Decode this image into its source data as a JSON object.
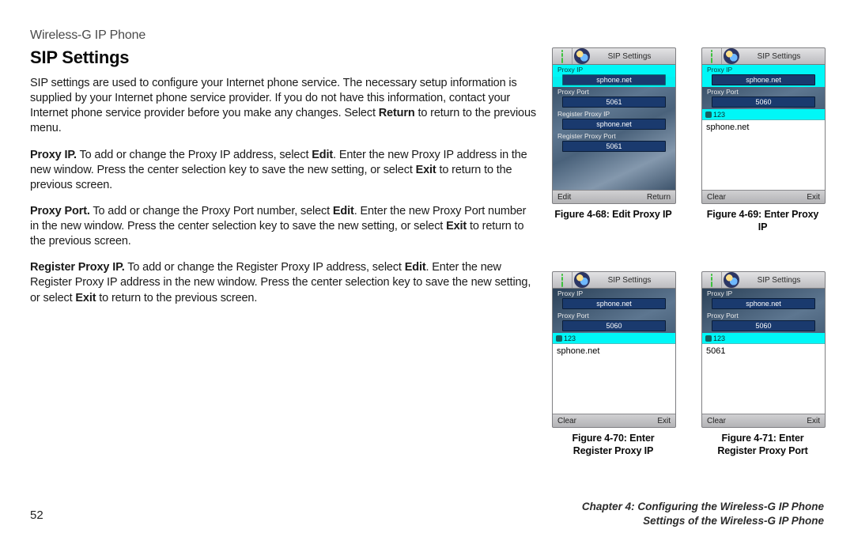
{
  "header": {
    "eyebrow": "Wireless-G IP Phone"
  },
  "section": {
    "title": "SIP Settings"
  },
  "paragraphs": {
    "intro_a": "SIP settings are used to configure your Internet phone service. The necessary setup information is supplied by your Internet phone service provider. If you do not have this information, contact your Internet phone service provider before you make any changes. Select ",
    "intro_b_bold": "Return",
    "intro_c": " to return to the previous menu.",
    "proxy_ip_b": "Proxy IP.",
    "proxy_ip_1": " To add or change the Proxy IP address, select ",
    "proxy_ip_edit": "Edit",
    "proxy_ip_2": ". Enter the new Proxy IP address in the new window. Press the center selection key to save the new setting, or select ",
    "proxy_ip_exit": "Exit",
    "proxy_ip_3": " to return to the previous screen.",
    "proxy_port_b": "Proxy Port.",
    "proxy_port_1": " To add or change the Proxy Port number, select ",
    "proxy_port_edit": "Edit",
    "proxy_port_2": ". Enter the new Proxy Port number in the new window. Press the center selection key to save the new setting, or select ",
    "proxy_port_exit": "Exit",
    "proxy_port_3": " to return to the previous screen.",
    "reg_b": "Register Proxy IP.",
    "reg_1": " To add or change the Register Proxy IP address, select ",
    "reg_edit": "Edit",
    "reg_2": ". Enter the new Register Proxy IP address in the new window. Press the center selection key to save the new setting, or select ",
    "reg_exit": "Exit",
    "reg_3": " to return to the previous screen."
  },
  "page_number": "52",
  "footer": {
    "line1": "Chapter 4: Configuring the Wireless-G IP Phone",
    "line2": "Settings of the Wireless-G IP Phone"
  },
  "phones": {
    "fig68": {
      "title": "SIP Settings",
      "fields": [
        {
          "label": "Proxy IP",
          "value": "sphone.net",
          "selected": true
        },
        {
          "label": "Proxy Port",
          "value": "5061"
        },
        {
          "label": "Register Proxy IP",
          "value": "sphone.net"
        },
        {
          "label": "Register Proxy Port",
          "value": "5061"
        }
      ],
      "soft_left": "Edit",
      "soft_right": "Return",
      "caption": "Figure 4-68: Edit Proxy IP"
    },
    "fig69": {
      "title": "SIP Settings",
      "fields": [
        {
          "label": "Proxy IP",
          "value": "sphone.net",
          "selected": true
        },
        {
          "label": "Proxy Port",
          "value": "5060"
        }
      ],
      "entry_label": "123",
      "input": "sphone.net",
      "soft_left": "Clear",
      "soft_right": "Exit",
      "caption": "Figure 4-69: Enter Proxy IP"
    },
    "fig70": {
      "title": "SIP Settings",
      "fields": [
        {
          "label": "Proxy IP",
          "value": "sphone.net"
        },
        {
          "label": "Proxy Port",
          "value": "5060"
        }
      ],
      "entry_label": "123",
      "input": "sphone.net",
      "soft_left": "Clear",
      "soft_right": "Exit",
      "caption": "Figure 4-70: Enter Register Proxy IP"
    },
    "fig71": {
      "title": "SIP Settings",
      "fields": [
        {
          "label": "Proxy IP",
          "value": "sphone.net"
        },
        {
          "label": "Proxy Port",
          "value": "5060"
        }
      ],
      "entry_label": "123",
      "input": "5061",
      "soft_left": "Clear",
      "soft_right": "Exit",
      "caption": "Figure 4-71: Enter Register Proxy Port"
    }
  }
}
